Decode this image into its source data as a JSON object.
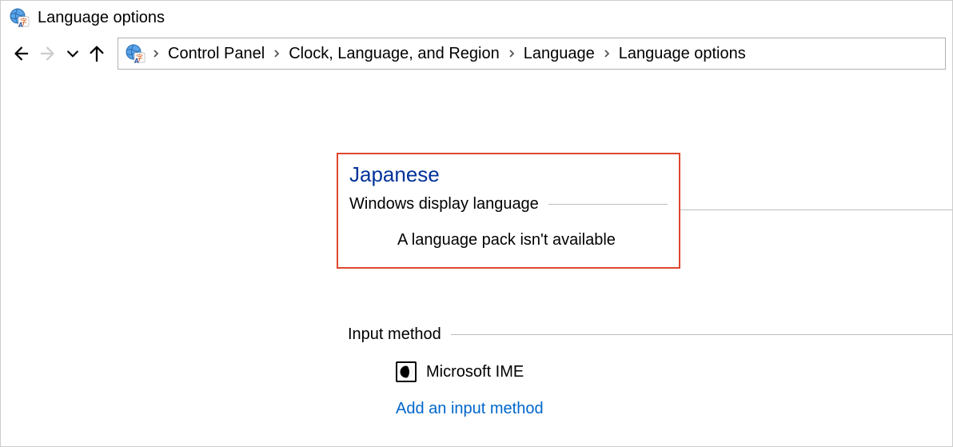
{
  "window": {
    "title": "Language options"
  },
  "breadcrumbs": {
    "items": [
      "Control Panel",
      "Clock, Language, and Region",
      "Language",
      "Language options"
    ]
  },
  "main": {
    "language_name": "Japanese",
    "display_section_label": "Windows display language",
    "display_status": "A language pack isn't available",
    "input_section_label": "Input method",
    "ime_name": "Microsoft IME",
    "add_input_link": "Add an input method"
  }
}
